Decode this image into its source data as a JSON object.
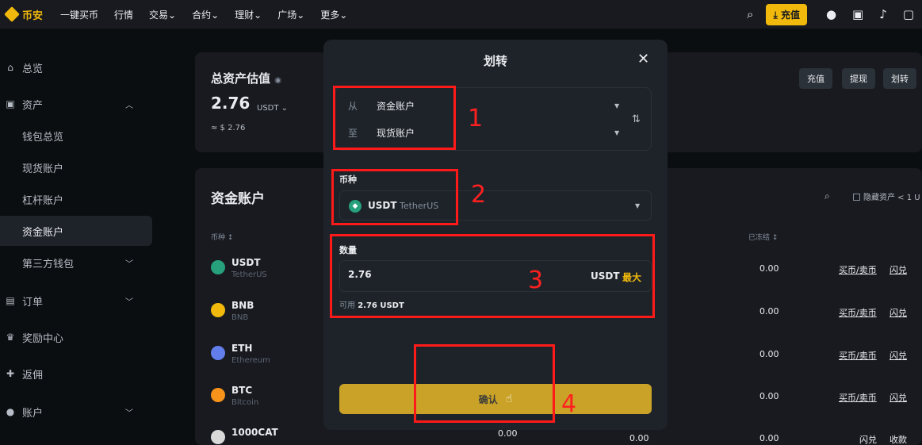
{
  "nav": {
    "logo": "币安",
    "items": [
      "一键买币",
      "行情",
      "交易⌄",
      "合约⌄",
      "理财⌄",
      "广场⌄",
      "更多⌄"
    ],
    "deposit": "充值"
  },
  "sidebar": {
    "items": [
      {
        "label": "总览",
        "icon": "home-icon",
        "glyph": "⌂"
      },
      {
        "label": "资产",
        "icon": "wallet-icon",
        "glyph": "▣"
      },
      {
        "label": "钱包总览"
      },
      {
        "label": "现货账户"
      },
      {
        "label": "杠杆账户"
      },
      {
        "label": "资金账户"
      },
      {
        "label": "第三方钱包"
      },
      {
        "label": "订单",
        "icon": "orders-icon",
        "glyph": "▤"
      },
      {
        "label": "奖励中心",
        "icon": "rewards-icon",
        "glyph": "♛"
      },
      {
        "label": "返佣",
        "icon": "referral-icon",
        "glyph": "✚"
      },
      {
        "label": "账户",
        "icon": "account-icon",
        "glyph": "●"
      }
    ]
  },
  "overview": {
    "title": "总资产估值",
    "value": "2.76",
    "unit": "USDT ⌄",
    "fiat": "≈ $ 2.76",
    "actions": [
      "充值",
      "提现",
      "划转"
    ]
  },
  "funding": {
    "title": "资金账户",
    "col_coin": "币种 ↕",
    "col_frozen": "已冻结 ↕",
    "hide_small": "隐藏资产 < 1 U",
    "coins": [
      {
        "sym": "USDT",
        "name": "TetherUS",
        "frozen": "0.00",
        "link1": "买币/卖币",
        "link2": "闪兑",
        "color": "#26a17b"
      },
      {
        "sym": "BNB",
        "name": "BNB",
        "frozen": "0.00",
        "link1": "买币/卖币",
        "link2": "闪兑",
        "color": "#f0b90b"
      },
      {
        "sym": "ETH",
        "name": "Ethereum",
        "frozen": "0.00",
        "link1": "买币/卖币",
        "link2": "闪兑",
        "color": "#627eea"
      },
      {
        "sym": "BTC",
        "name": "Bitcoin",
        "frozen": "0.00",
        "link1": "买币/卖币",
        "link2": "闪兑",
        "color": "#f7931a"
      },
      {
        "sym": "1000CAT",
        "name": "",
        "frozen": "0.00",
        "link1": "闪兑",
        "link2": "收款",
        "color": "#d9d9d9",
        "extra1": "0.00",
        "extra2": "0.00"
      }
    ]
  },
  "modal": {
    "title": "划转",
    "from_label": "从",
    "from_value": "资金账户",
    "to_label": "至",
    "to_value": "现货账户",
    "coin_label": "币种",
    "coin_sym": "USDT",
    "coin_name": "TetherUS",
    "amount_label": "数量",
    "amount_value": "2.76",
    "amount_unit": "USDT",
    "amount_max": "最大",
    "available_label": "可用",
    "available_value": "2.76 USDT",
    "confirm": "确认"
  },
  "annotations": [
    "1",
    "2",
    "3",
    "4"
  ]
}
